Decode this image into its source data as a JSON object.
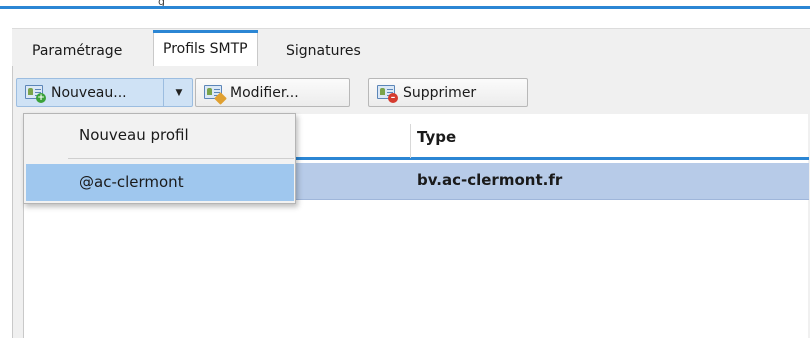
{
  "window": {
    "title_fragment": "g"
  },
  "tabs": [
    {
      "label": "Paramétrage",
      "active": false
    },
    {
      "label": "Profils SMTP",
      "active": true
    },
    {
      "label": "Signatures",
      "active": false
    }
  ],
  "toolbar": {
    "new_label": "Nouveau...",
    "modify_label": "Modifier...",
    "delete_label": "Supprimer"
  },
  "table": {
    "columns": [
      "",
      "Type"
    ],
    "rows": [
      {
        "name": "",
        "type": "bv.ac-clermont.fr",
        "selected": true
      }
    ]
  },
  "dropdown": {
    "items": [
      {
        "label": "Nouveau profil",
        "highlighted": false
      },
      {
        "label": "@ac-clermont",
        "highlighted": true
      }
    ]
  },
  "colors": {
    "accent": "#2b86d4",
    "selection": "#b7cbe8",
    "menu_highlight": "#9fc7ee"
  }
}
